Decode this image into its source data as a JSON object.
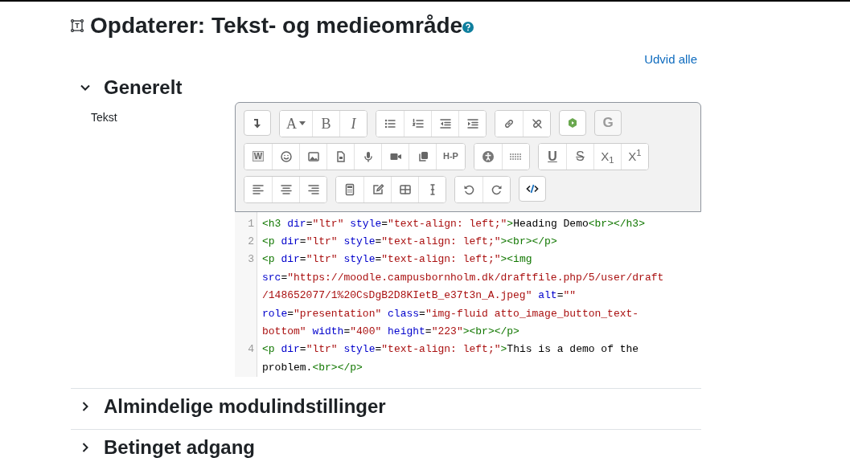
{
  "page_title": "Opdaterer: Tekst- og medieområde",
  "expand_all": "Udvid alle",
  "sections": [
    {
      "title": "Generelt",
      "expanded": true
    },
    {
      "title": "Almindelige modulindstillinger",
      "expanded": false
    },
    {
      "title": "Betinget adgang",
      "expanded": false
    }
  ],
  "field_label": "Tekst",
  "toolbar": [
    [
      [
        {
          "kind": "collapse",
          "disabled": false
        }
      ],
      [
        {
          "kind": "font",
          "glyph": "A",
          "disabled": false
        },
        {
          "kind": "bold",
          "glyph": "B",
          "disabled": false
        },
        {
          "kind": "italic",
          "glyph": "I",
          "disabled": false
        }
      ],
      [
        {
          "kind": "bullets",
          "disabled": false
        },
        {
          "kind": "numbers",
          "disabled": false
        },
        {
          "kind": "outdent",
          "disabled": false
        },
        {
          "kind": "indent",
          "disabled": false
        }
      ],
      [
        {
          "kind": "link",
          "disabled": false
        },
        {
          "kind": "unlink",
          "disabled": false
        }
      ],
      [
        {
          "kind": "recycle",
          "disabled": false
        }
      ],
      [
        {
          "kind": "spell",
          "glyph": "G",
          "disabled": true
        }
      ]
    ],
    [
      [
        {
          "kind": "word",
          "glyph": "W",
          "disabled": false
        },
        {
          "kind": "emoji",
          "disabled": false
        },
        {
          "kind": "image",
          "disabled": false
        },
        {
          "kind": "file",
          "disabled": false
        },
        {
          "kind": "mic",
          "disabled": false
        },
        {
          "kind": "video",
          "disabled": false
        },
        {
          "kind": "copy",
          "disabled": false
        },
        {
          "kind": "h5p",
          "glyph": "H-P",
          "disabled": false
        }
      ],
      [
        {
          "kind": "accessibility",
          "disabled": false
        },
        {
          "kind": "grid",
          "disabled": false
        }
      ],
      [
        {
          "kind": "underline",
          "glyph": "U",
          "disabled": false
        },
        {
          "kind": "strike",
          "glyph": "S",
          "disabled": false
        },
        {
          "kind": "subscript",
          "glyph": "X$_{1}$",
          "disabled": false
        },
        {
          "kind": "superscript",
          "glyph": "X$^{1}$",
          "disabled": false
        }
      ]
    ],
    [
      [
        {
          "kind": "align-left",
          "disabled": false
        },
        {
          "kind": "align-center",
          "disabled": false
        },
        {
          "kind": "align-right",
          "disabled": false
        }
      ],
      [
        {
          "kind": "calculator",
          "disabled": false
        },
        {
          "kind": "pencil",
          "disabled": false
        },
        {
          "kind": "table",
          "disabled": false
        },
        {
          "kind": "cursor",
          "disabled": false
        }
      ],
      [
        {
          "kind": "undo",
          "disabled": false
        },
        {
          "kind": "redo",
          "disabled": false
        }
      ],
      [
        {
          "kind": "code",
          "disabled": false
        }
      ]
    ]
  ],
  "code_lines": [
    {
      "number": "1",
      "tokens": [
        {
          "kind": "tag",
          "text": "<h3"
        },
        {
          "kind": "attr",
          "text": " dir"
        },
        {
          "kind": "text",
          "text": "="
        },
        {
          "kind": "string",
          "text": "\"ltr\""
        },
        {
          "kind": "attr",
          "text": " style"
        },
        {
          "kind": "text",
          "text": "="
        },
        {
          "kind": "string",
          "text": "\"text-align: left;\""
        },
        {
          "kind": "tag",
          "text": ">"
        },
        {
          "kind": "text",
          "text": "Heading Demo"
        },
        {
          "kind": "tag",
          "text": "<br></h3>"
        }
      ]
    },
    {
      "number": "2",
      "tokens": [
        {
          "kind": "tag",
          "text": "<p"
        },
        {
          "kind": "attr",
          "text": " dir"
        },
        {
          "kind": "text",
          "text": "="
        },
        {
          "kind": "string",
          "text": "\"ltr\""
        },
        {
          "kind": "attr",
          "text": " style"
        },
        {
          "kind": "text",
          "text": "="
        },
        {
          "kind": "string",
          "text": "\"text-align: left;\""
        },
        {
          "kind": "tag",
          "text": "><br></p>"
        }
      ]
    },
    {
      "number": "3",
      "tokens": [
        {
          "kind": "tag",
          "text": "<p"
        },
        {
          "kind": "attr",
          "text": " dir"
        },
        {
          "kind": "text",
          "text": "="
        },
        {
          "kind": "string",
          "text": "\"ltr\""
        },
        {
          "kind": "attr",
          "text": " style"
        },
        {
          "kind": "text",
          "text": "="
        },
        {
          "kind": "string",
          "text": "\"text-align: left;\""
        },
        {
          "kind": "tag",
          "text": "><img"
        },
        {
          "kind": "attr",
          "text": " src"
        },
        {
          "kind": "text",
          "text": "="
        },
        {
          "kind": "string",
          "text": "\"https://moodle.campusbornholm.dk/draftfile.php/5/user/draft/148652077/1%20CsDgB2D8KIetB_e37t3n_A.jpeg\""
        },
        {
          "kind": "attr",
          "text": " alt"
        },
        {
          "kind": "text",
          "text": "="
        },
        {
          "kind": "string",
          "text": "\"\""
        },
        {
          "kind": "attr",
          "text": " role"
        },
        {
          "kind": "text",
          "text": "="
        },
        {
          "kind": "string",
          "text": "\"presentation\""
        },
        {
          "kind": "attr",
          "text": " class"
        },
        {
          "kind": "text",
          "text": "="
        },
        {
          "kind": "string",
          "text": "\"img-fluid atto_image_button_text-bottom\""
        },
        {
          "kind": "attr",
          "text": " width"
        },
        {
          "kind": "text",
          "text": "="
        },
        {
          "kind": "string",
          "text": "\"400\""
        },
        {
          "kind": "attr",
          "text": " height"
        },
        {
          "kind": "text",
          "text": "="
        },
        {
          "kind": "string",
          "text": "\"223\""
        },
        {
          "kind": "tag",
          "text": "><br></p>"
        }
      ]
    },
    {
      "number": "4",
      "tokens": [
        {
          "kind": "tag",
          "text": "<p"
        },
        {
          "kind": "attr",
          "text": " dir"
        },
        {
          "kind": "text",
          "text": "="
        },
        {
          "kind": "string",
          "text": "\"ltr\""
        },
        {
          "kind": "attr",
          "text": " style"
        },
        {
          "kind": "text",
          "text": "="
        },
        {
          "kind": "string",
          "text": "\"text-align: left;\""
        },
        {
          "kind": "tag",
          "text": ">"
        },
        {
          "kind": "text",
          "text": "This is a demo of the problem."
        },
        {
          "kind": "tag",
          "text": "<br></p>"
        }
      ]
    }
  ]
}
